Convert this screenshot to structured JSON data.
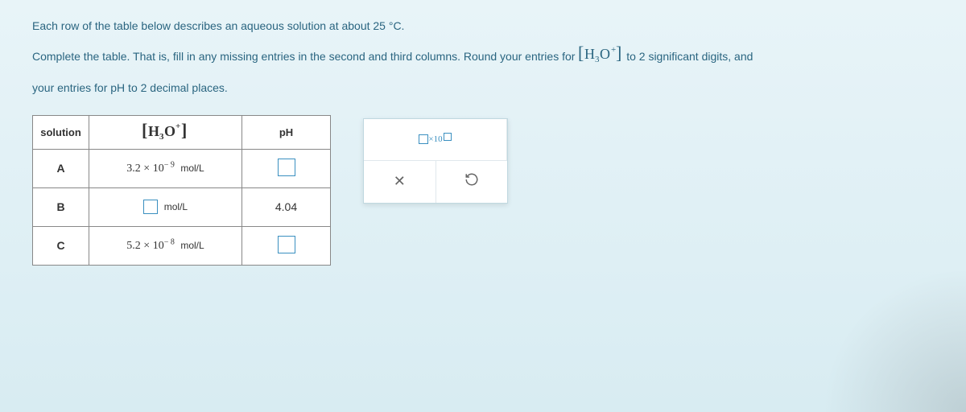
{
  "question": {
    "line1": "Each row of the table below describes an aqueous solution at about 25 °C.",
    "line2_a": "Complete the table. That is, fill in any missing entries in the second and third columns. Round your entries for ",
    "line2_b": " to 2 significant digits, and",
    "line3": "your entries for pH to 2 decimal places."
  },
  "table": {
    "headers": {
      "solution": "solution",
      "ph": "pH"
    },
    "rows": [
      {
        "label": "A",
        "h3o_coeff": "3.2",
        "h3o_base": "10",
        "h3o_exp": "− 9",
        "h3o_unit": "mol/L",
        "ph": ""
      },
      {
        "label": "B",
        "h3o_unit": "mol/L",
        "ph": "4.04"
      },
      {
        "label": "C",
        "h3o_coeff": "5.2",
        "h3o_base": "10",
        "h3o_exp": "− 8",
        "h3o_unit": "mol/L",
        "ph": ""
      }
    ]
  },
  "toolbox": {
    "x10_label": "×10"
  }
}
